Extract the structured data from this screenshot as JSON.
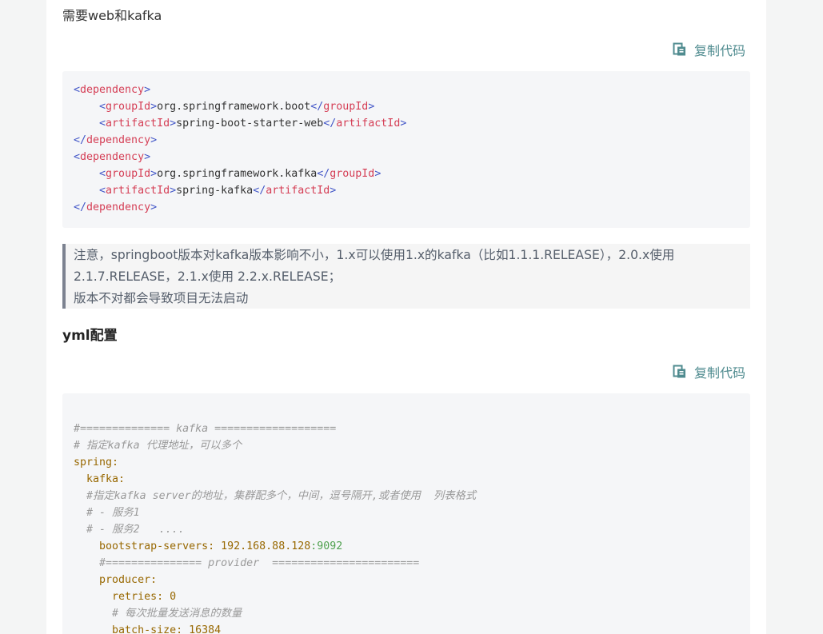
{
  "intro_text": "需要web和kafka",
  "copy_label": "复制代码",
  "xml_code": {
    "lines": [
      [
        {
          "t": "<",
          "c": "tk-punct"
        },
        {
          "t": "dependency",
          "c": "tk-tag"
        },
        {
          "t": ">",
          "c": "tk-punct"
        }
      ],
      [
        {
          "t": "    ",
          "c": "tk-text"
        },
        {
          "t": "<",
          "c": "tk-punct"
        },
        {
          "t": "groupId",
          "c": "tk-tag"
        },
        {
          "t": ">",
          "c": "tk-punct"
        },
        {
          "t": "org.springframework.boot",
          "c": "tk-text"
        },
        {
          "t": "</",
          "c": "tk-punct"
        },
        {
          "t": "groupId",
          "c": "tk-tag"
        },
        {
          "t": ">",
          "c": "tk-punct"
        }
      ],
      [
        {
          "t": "    ",
          "c": "tk-text"
        },
        {
          "t": "<",
          "c": "tk-punct"
        },
        {
          "t": "artifactId",
          "c": "tk-tag"
        },
        {
          "t": ">",
          "c": "tk-punct"
        },
        {
          "t": "spring-boot-starter-web",
          "c": "tk-text"
        },
        {
          "t": "</",
          "c": "tk-punct"
        },
        {
          "t": "artifactId",
          "c": "tk-tag"
        },
        {
          "t": ">",
          "c": "tk-punct"
        }
      ],
      [
        {
          "t": "</",
          "c": "tk-punct"
        },
        {
          "t": "dependency",
          "c": "tk-tag"
        },
        {
          "t": ">",
          "c": "tk-punct"
        }
      ],
      [
        {
          "t": "<",
          "c": "tk-punct"
        },
        {
          "t": "dependency",
          "c": "tk-tag"
        },
        {
          "t": ">",
          "c": "tk-punct"
        }
      ],
      [
        {
          "t": "    ",
          "c": "tk-text"
        },
        {
          "t": "<",
          "c": "tk-punct"
        },
        {
          "t": "groupId",
          "c": "tk-tag"
        },
        {
          "t": ">",
          "c": "tk-punct"
        },
        {
          "t": "org.springframework.kafka",
          "c": "tk-text"
        },
        {
          "t": "</",
          "c": "tk-punct"
        },
        {
          "t": "groupId",
          "c": "tk-tag"
        },
        {
          "t": ">",
          "c": "tk-punct"
        }
      ],
      [
        {
          "t": "    ",
          "c": "tk-text"
        },
        {
          "t": "<",
          "c": "tk-punct"
        },
        {
          "t": "artifactId",
          "c": "tk-tag"
        },
        {
          "t": ">",
          "c": "tk-punct"
        },
        {
          "t": "spring-kafka",
          "c": "tk-text"
        },
        {
          "t": "</",
          "c": "tk-punct"
        },
        {
          "t": "artifactId",
          "c": "tk-tag"
        },
        {
          "t": ">",
          "c": "tk-punct"
        }
      ],
      [
        {
          "t": "</",
          "c": "tk-punct"
        },
        {
          "t": "dependency",
          "c": "tk-tag"
        },
        {
          "t": ">",
          "c": "tk-punct"
        }
      ]
    ]
  },
  "note": {
    "line1": "注意，springboot版本对kafka版本影响不小，1.x可以使用1.x的kafka（比如1.1.1.RELEASE），2.0.x使用",
    "line2": "2.1.7.RELEASE，2.1.x使用 2.2.x.RELEASE；",
    "line3": "版本不对都会导致项目无法启动"
  },
  "yml_heading": "yml配置",
  "yml_code": {
    "lines": [
      [
        {
          "t": "",
          "c": "tk-text"
        }
      ],
      [
        {
          "t": "#============== kafka ===================",
          "c": "tk-comment"
        }
      ],
      [
        {
          "t": "# 指定kafka 代理地址，可以多个",
          "c": "tk-comment"
        }
      ],
      [
        {
          "t": "spring:",
          "c": "tk-key"
        }
      ],
      [
        {
          "t": "  ",
          "c": "tk-text"
        },
        {
          "t": "kafka:",
          "c": "tk-key"
        }
      ],
      [
        {
          "t": "  ",
          "c": "tk-text"
        },
        {
          "t": "#指定kafka server的地址，集群配多个，中间，逗号隔开,或者使用  列表格式",
          "c": "tk-comment"
        }
      ],
      [
        {
          "t": "  ",
          "c": "tk-text"
        },
        {
          "t": "# - 服务1",
          "c": "tk-comment"
        }
      ],
      [
        {
          "t": "  ",
          "c": "tk-text"
        },
        {
          "t": "# - 服务2   ....",
          "c": "tk-comment"
        }
      ],
      [
        {
          "t": "    ",
          "c": "tk-text"
        },
        {
          "t": "bootstrap-servers: ",
          "c": "tk-key"
        },
        {
          "t": "192.168.88.128",
          "c": "tk-val"
        },
        {
          "t": ":9092",
          "c": "tk-num"
        }
      ],
      [
        {
          "t": "    ",
          "c": "tk-text"
        },
        {
          "t": "#=============== provider  =======================",
          "c": "tk-comment"
        }
      ],
      [
        {
          "t": "    ",
          "c": "tk-text"
        },
        {
          "t": "producer:",
          "c": "tk-key"
        }
      ],
      [
        {
          "t": "      ",
          "c": "tk-text"
        },
        {
          "t": "retries: ",
          "c": "tk-key"
        },
        {
          "t": "0",
          "c": "tk-val"
        }
      ],
      [
        {
          "t": "      ",
          "c": "tk-text"
        },
        {
          "t": "# 每次批量发送消息的数量",
          "c": "tk-comment"
        }
      ],
      [
        {
          "t": "      ",
          "c": "tk-text"
        },
        {
          "t": "batch-size: ",
          "c": "tk-key"
        },
        {
          "t": "16384",
          "c": "tk-val"
        }
      ]
    ]
  },
  "icons": {
    "copy": "copy-icon"
  }
}
